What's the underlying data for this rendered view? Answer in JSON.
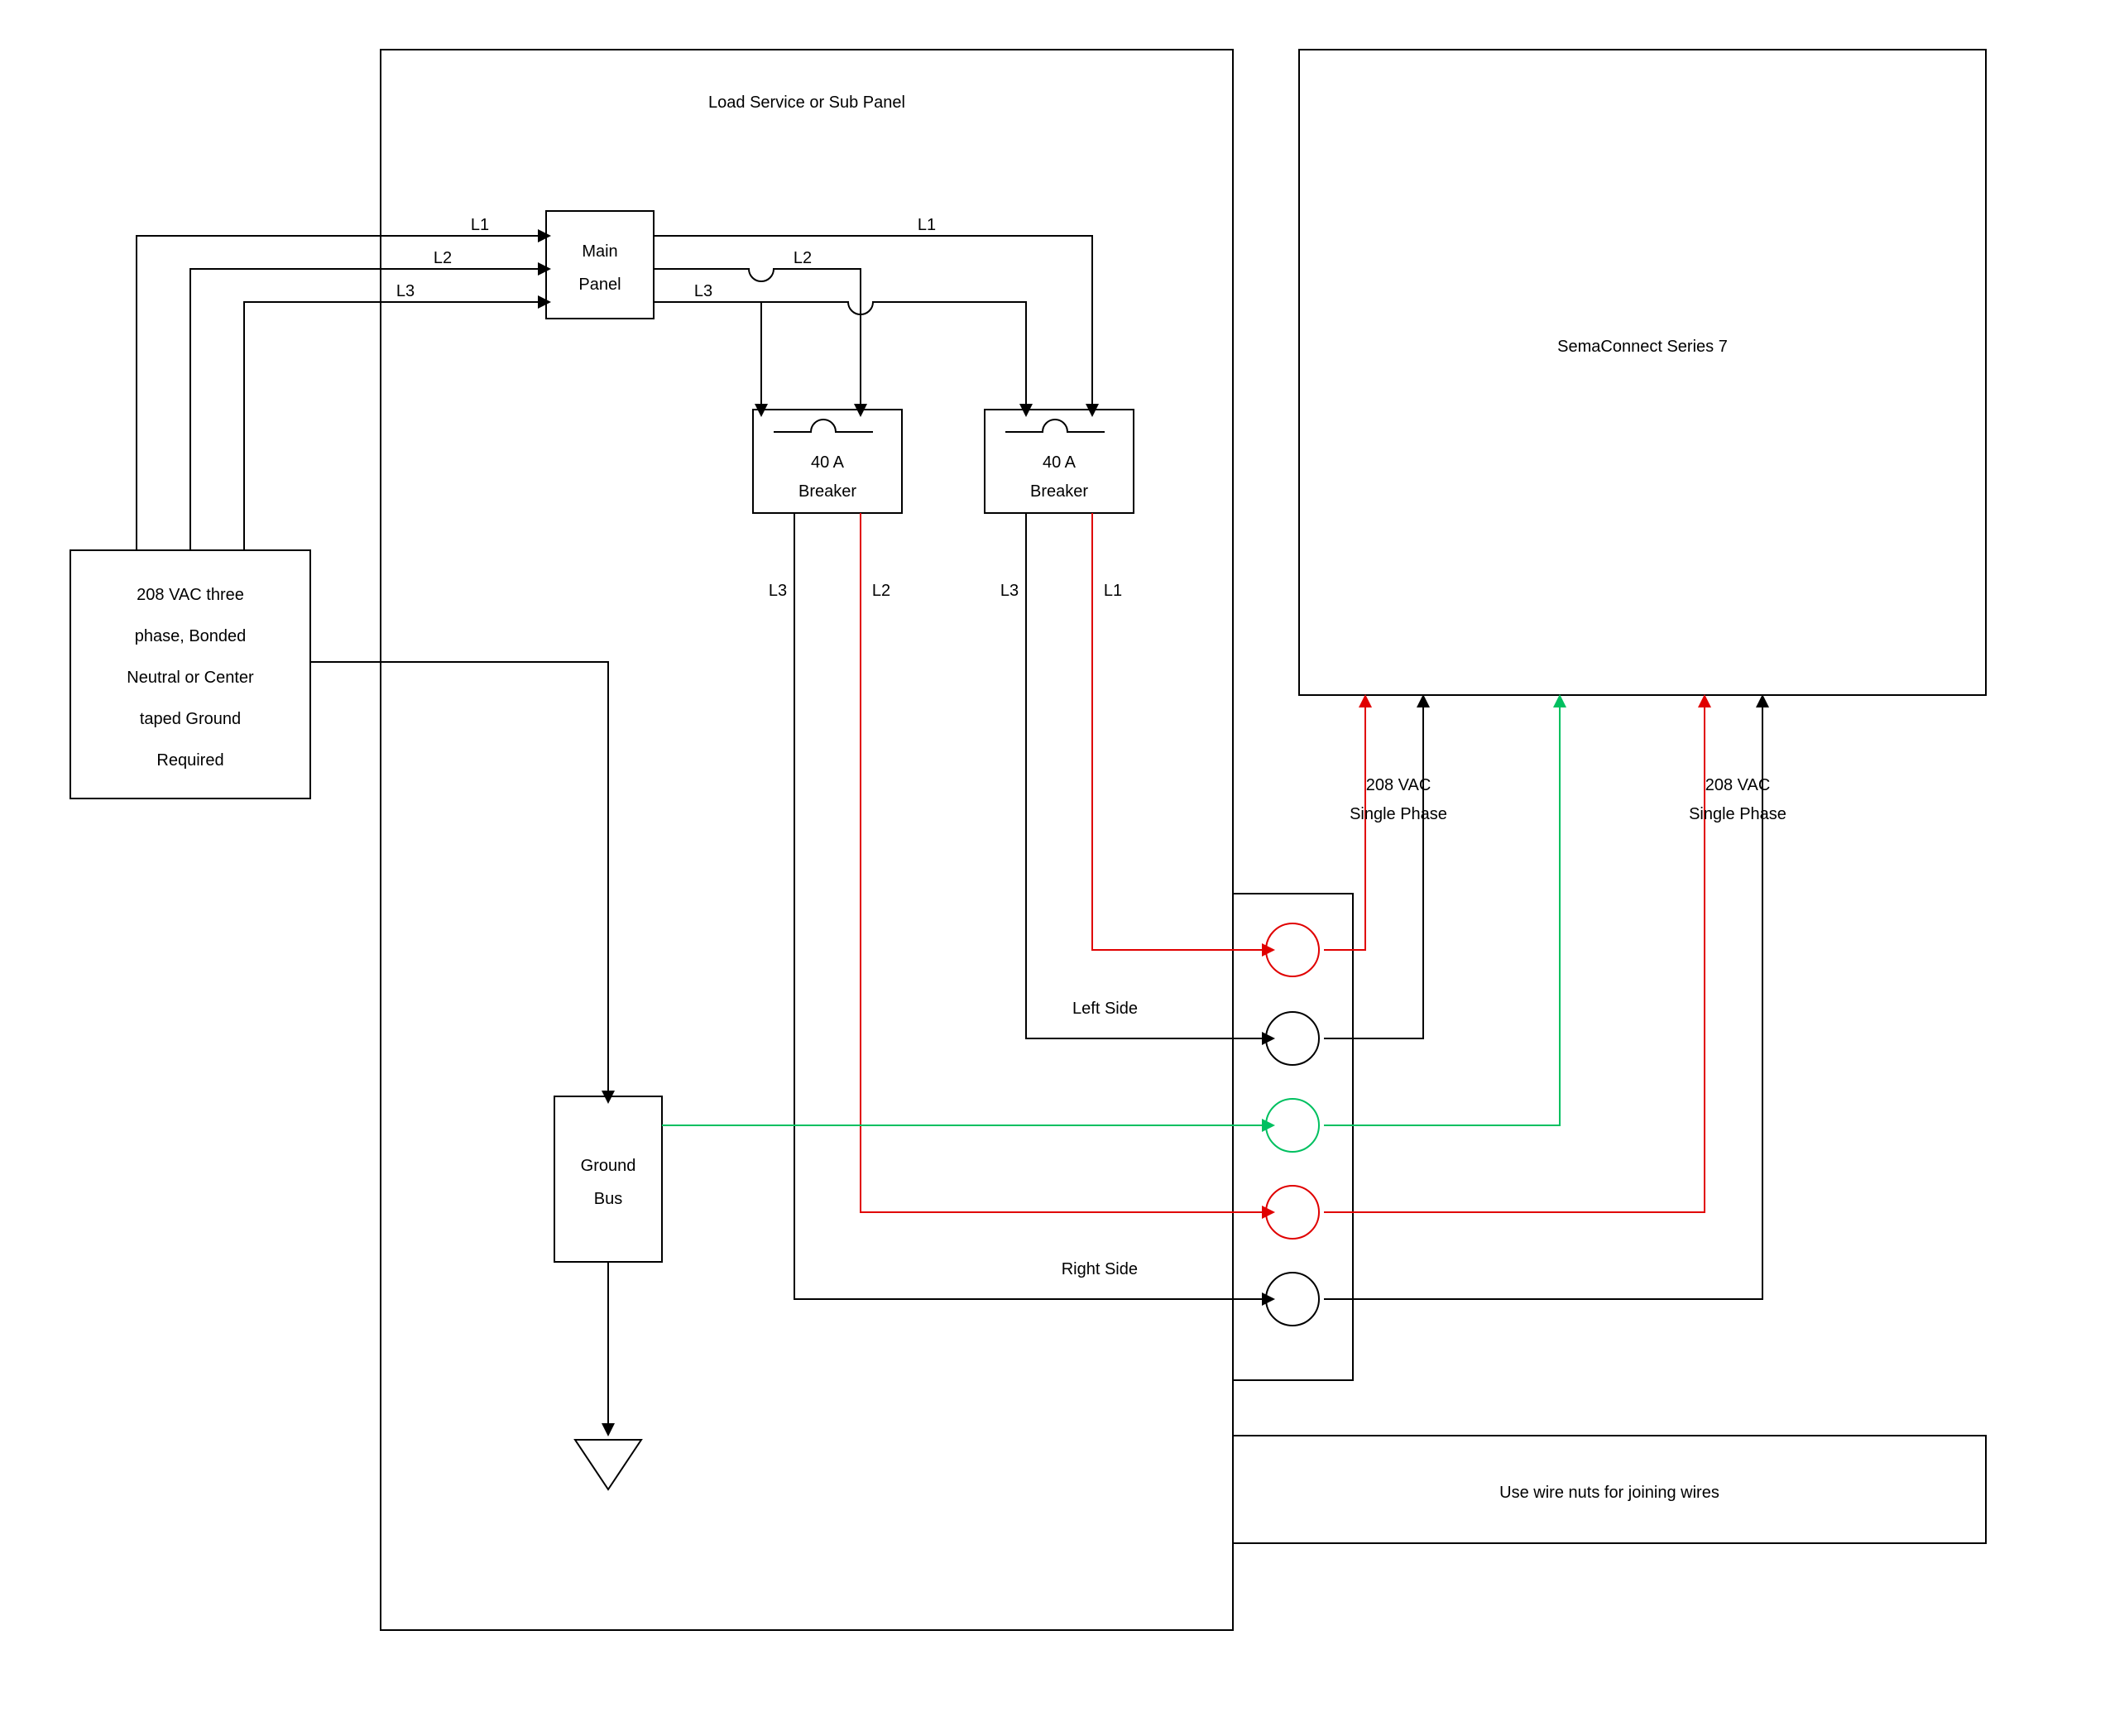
{
  "panel_title": "Load Service or Sub Panel",
  "source_box": {
    "l1": "208 VAC three",
    "l2": "phase, Bonded",
    "l3": "Neutral or Center",
    "l4": "taped Ground",
    "l5": "Required"
  },
  "main_panel": {
    "l1": "Main",
    "l2": "Panel"
  },
  "breaker": {
    "l1": "40 A",
    "l2": "Breaker"
  },
  "ground_bus": {
    "l1": "Ground",
    "l2": "Bus"
  },
  "sema": "SemaConnect Series 7",
  "left_side": "Left Side",
  "right_side": "Right Side",
  "joining_note": "Use wire nuts for joining wires",
  "phase_l1": "L1",
  "phase_l2": "L2",
  "phase_l3": "L3",
  "vac_l1": "208 VAC",
  "vac_l2": "Single Phase"
}
